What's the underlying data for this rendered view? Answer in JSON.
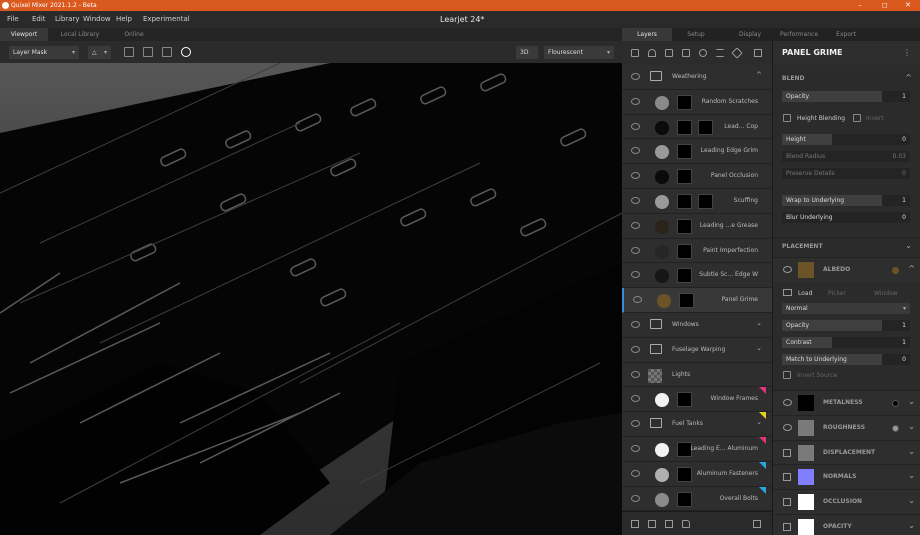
{
  "titlebar": {
    "app_name": "Quixel Mixer 2021.1.2 - Beta",
    "min": "–",
    "restore": "◻",
    "close": "✕"
  },
  "menu": {
    "items": [
      "File",
      "Edit",
      "Library",
      "Window",
      "Help",
      "Experimental"
    ],
    "document_title": "Learjet 24*"
  },
  "view_tabs": [
    "Viewport",
    "Local Library",
    "Online"
  ],
  "toolbar": {
    "layer_mask": "Layer Mask",
    "mode_3d": "3D",
    "lighting": "Flourescent"
  },
  "panel_tabs": [
    "Layers",
    "Setup",
    "Display",
    "Performance",
    "Export"
  ],
  "layers": [
    {
      "name": "Weathering",
      "type": "folder",
      "chevron": "up"
    },
    {
      "name": "Random Scratches",
      "type": "layer",
      "circle": "#8a8a8a"
    },
    {
      "name": "Lead... Cop",
      "type": "layer",
      "circle": "#0a0a0a",
      "mask2": true
    },
    {
      "name": "Leading Edge Grim",
      "type": "layer",
      "circle": "#9a9a9a"
    },
    {
      "name": "Panel Occlusion",
      "type": "layer",
      "circle": "#0a0a0a"
    },
    {
      "name": "Scuffing",
      "type": "layer",
      "circle": "#9a9a9a",
      "mask2": true
    },
    {
      "name": "Leading ...e Grease",
      "type": "layer",
      "circle": "#2b2318"
    },
    {
      "name": "Paint Imperfection",
      "type": "layer",
      "circle": "#262626"
    },
    {
      "name": "Subtle Sc... Edge W",
      "type": "layer",
      "circle": "#161616"
    },
    {
      "name": "Panel Grime",
      "type": "layer",
      "circle": "#6d5328",
      "selected": true
    },
    {
      "name": "Windows",
      "type": "folder",
      "chevron": "down"
    },
    {
      "name": "Fuselage Warping",
      "type": "folder",
      "chevron": "down"
    },
    {
      "name": "Lights",
      "type": "checker"
    },
    {
      "name": "Window Frames",
      "type": "layer",
      "circle": "#f2f2f2",
      "flag": "#e0357a"
    },
    {
      "name": "Fuel Tanks",
      "type": "folder",
      "chevron": "down",
      "flag": "#e6d01e"
    },
    {
      "name": "Leading E... Aluminum",
      "type": "layer",
      "circle": "#f2f2f2",
      "flag": "#e0357a"
    },
    {
      "name": "Aluminum Fasteners",
      "type": "layer",
      "circle": "#b0b0b0",
      "flag": "#2aa6e0"
    },
    {
      "name": "Overall Bolts",
      "type": "layer",
      "circle": "#8a8a8a",
      "flag": "#2aa6e0"
    }
  ],
  "props": {
    "title": "PANEL GRIME",
    "blend": {
      "section": "BLEND",
      "opacity": {
        "label": "Opacity",
        "value": "1"
      },
      "height_blending": "Height Blending",
      "invert": "Invert",
      "height": {
        "label": "Height",
        "value": "0"
      },
      "blend_radius": {
        "label": "Blend Radius",
        "value": "0.03"
      },
      "preserve_details": {
        "label": "Preserve Details",
        "value": "0"
      },
      "wrap": {
        "label": "Wrap to Underlying",
        "value": "1"
      },
      "blur": {
        "label": "Blur Underlying",
        "value": "0"
      }
    },
    "placement": {
      "section": "PLACEMENT"
    },
    "albedo": {
      "name": "ALBEDO",
      "swatch": "#6d5328",
      "load": "Load",
      "picker": "Picker",
      "window": "Window",
      "blend_mode": "Normal",
      "opacity": {
        "label": "Opacity",
        "value": "1"
      },
      "contrast": {
        "label": "Contrast",
        "value": "1"
      },
      "match": {
        "label": "Match to Underlying",
        "value": "0"
      },
      "invert_source": "Invert Source"
    },
    "channels": [
      {
        "name": "METALNESS",
        "swatch": "#000000",
        "dot": "#000000",
        "eye": true
      },
      {
        "name": "ROUGHNESS",
        "swatch": "#7a7a7a",
        "dot": "#9a9a9a",
        "eye": true
      },
      {
        "name": "DISPLACEMENT",
        "swatch": "#7a7a7a",
        "eye": false
      },
      {
        "name": "NORMALS",
        "swatch": "#8080ff",
        "eye": false
      },
      {
        "name": "OCCLUSION",
        "swatch": "#ffffff",
        "eye": false
      },
      {
        "name": "OPACITY",
        "swatch": "#ffffff",
        "eye": false
      }
    ]
  }
}
